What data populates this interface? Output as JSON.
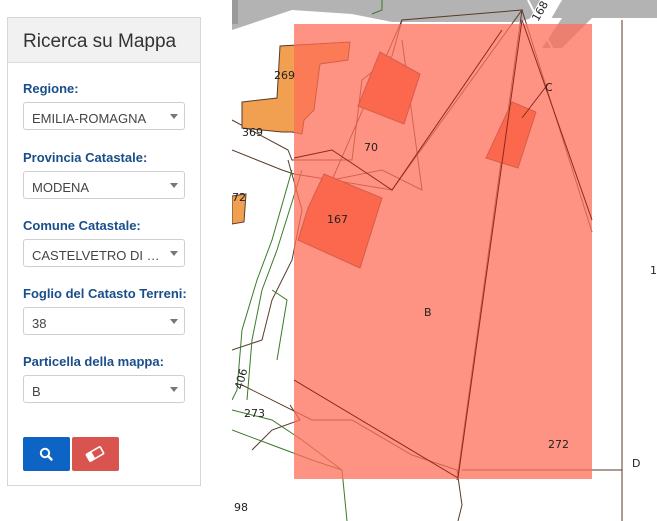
{
  "panel": {
    "title": "Ricerca su Mappa",
    "fields": [
      {
        "label": "Regione:",
        "value": "EMILIA-ROMAGNA"
      },
      {
        "label": "Provincia Catastale:",
        "value": "MODENA"
      },
      {
        "label": "Comune Catastale:",
        "value": "CASTELVETRO DI M..."
      },
      {
        "label": "Foglio del Catasto Terreni:",
        "value": "38"
      },
      {
        "label": "Particella della mappa:",
        "value": "B"
      }
    ],
    "buttons": {
      "search_icon": "search-icon",
      "clear_icon": "eraser-icon"
    }
  },
  "map": {
    "colors": {
      "highlight": "#ff6f5a",
      "building": "#f0562b",
      "parcel_orange": "#f0a050",
      "road": "#b0b0b0",
      "line_green": "#3a7a2a"
    },
    "labels": [
      "269",
      "369",
      "70",
      "C",
      "72",
      "167",
      "B",
      "406",
      "273",
      "272",
      "D",
      "98",
      "168",
      "1"
    ]
  }
}
